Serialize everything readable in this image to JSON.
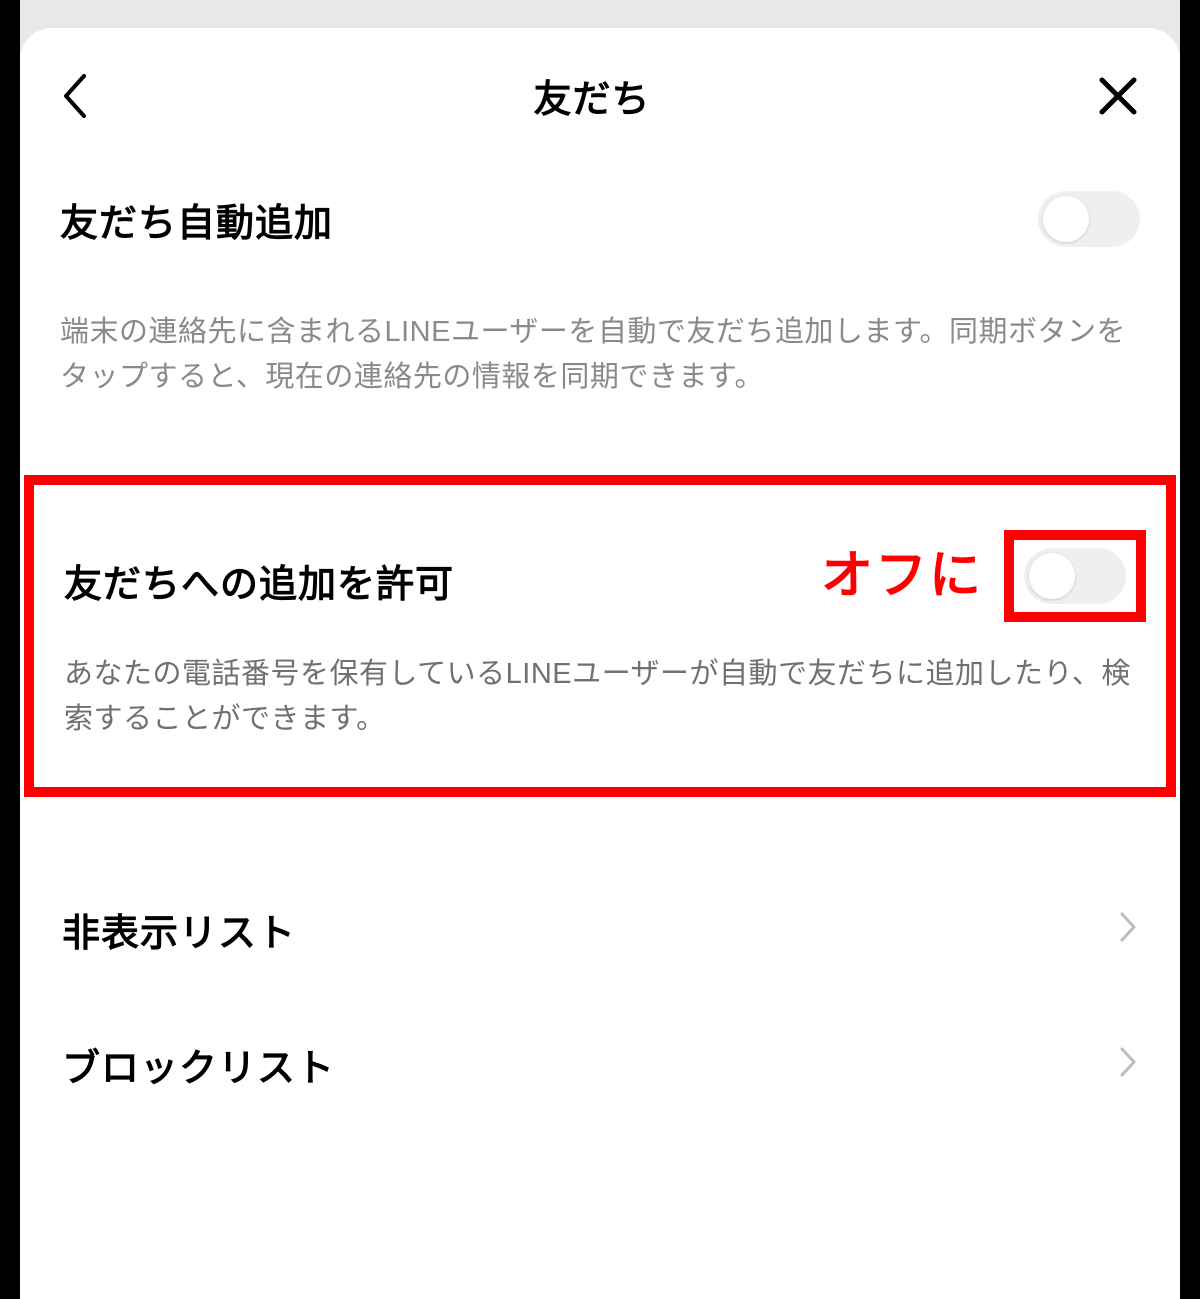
{
  "header": {
    "title": "友だち"
  },
  "settings": {
    "auto_add": {
      "label": "友だち自動追加",
      "description": "端末の連絡先に含まれるLINEユーザーを自動で友だち追加します。同期ボタンをタップすると、現在の連絡先の情報を同期できます。",
      "enabled": false
    },
    "allow_add": {
      "label": "友だちへの追加を許可",
      "description": "あなたの電話番号を保有しているLINEユーザーが自動で友だちに追加したり、検索することができます。",
      "enabled": false,
      "annotation": "オフに"
    }
  },
  "lists": {
    "hidden": {
      "label": "非表示リスト"
    },
    "block": {
      "label": "ブロックリスト"
    }
  },
  "colors": {
    "highlight": "#ff0000"
  }
}
